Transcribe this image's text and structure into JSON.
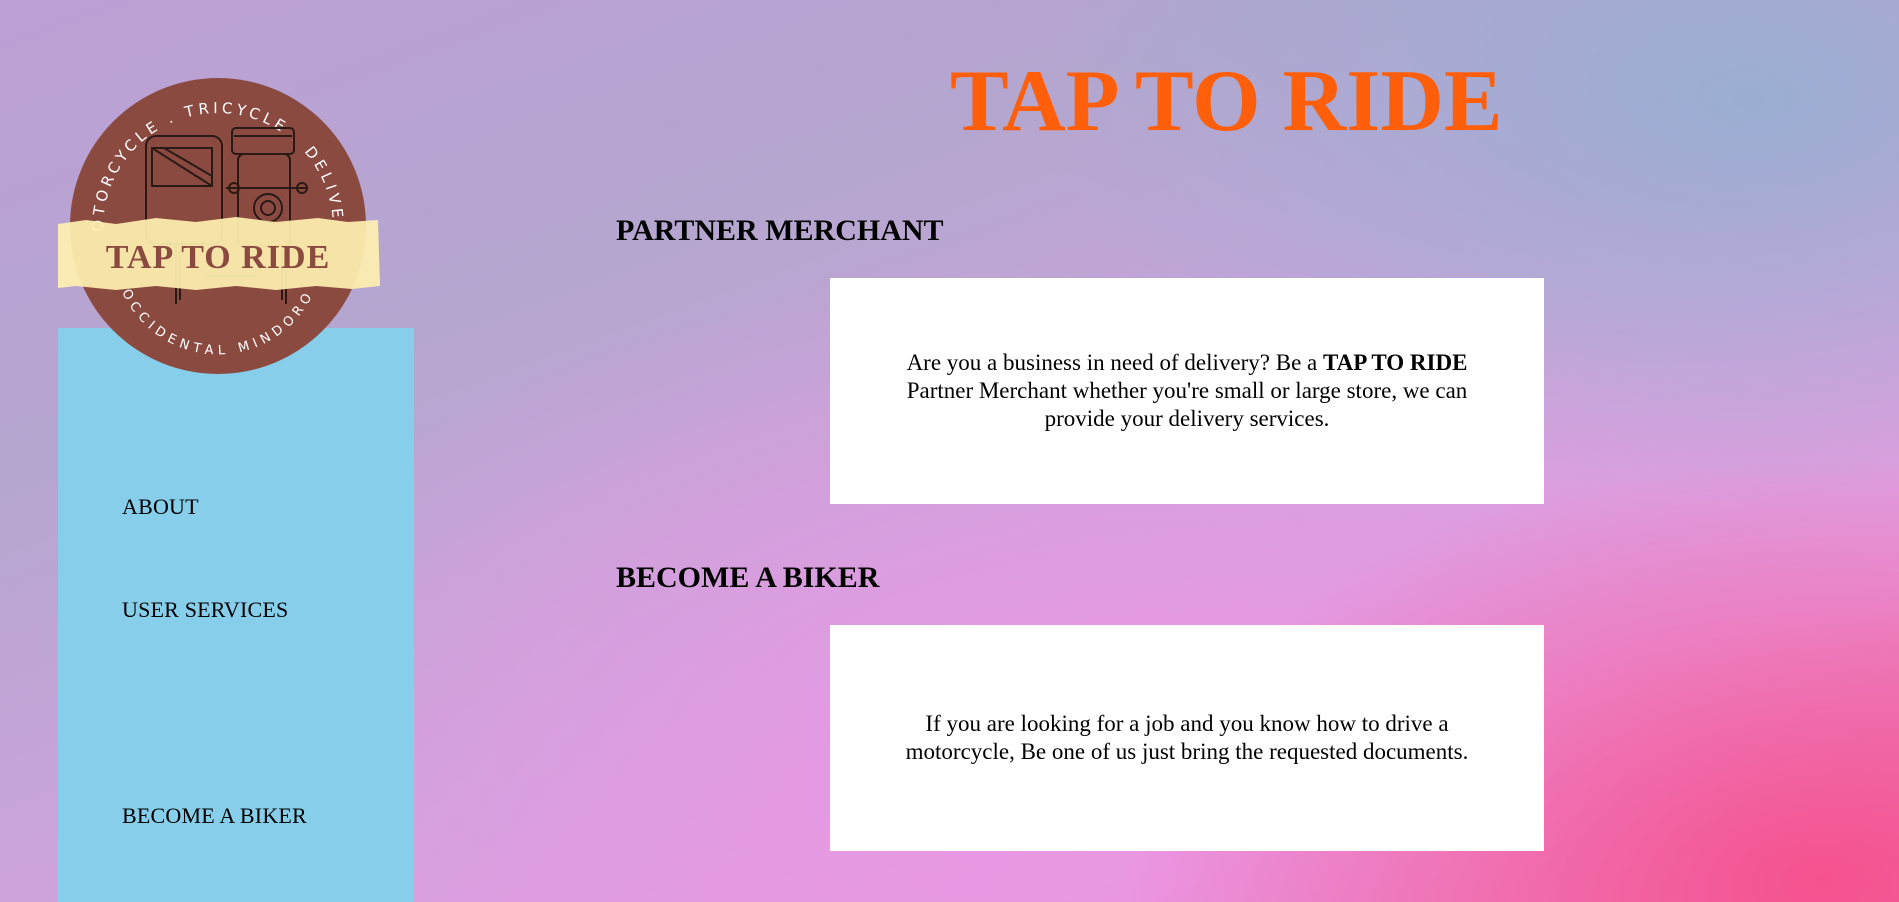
{
  "logo": {
    "top_arc": "MOTORCYCLE . TRICYCLE . DELIVERY",
    "bottom_arc": "OCCIDENTAL MINDORO",
    "banner": "TAP TO RIDE",
    "color_brown": "#8b4a3f",
    "color_banner": "#fff0b0"
  },
  "nav": {
    "about": "ABOUT",
    "user_services": "USER SERVICES",
    "become_biker": "BECOME A BIKER",
    "background": "#87ceeb"
  },
  "hero": {
    "title": "TAP TO RIDE",
    "color": "#ff5f0a"
  },
  "sections": {
    "merchant": {
      "heading": "PARTNER MERCHANT",
      "text_before": "Are you a business in need of delivery? Be a ",
      "text_bold": "TAP TO RIDE",
      "text_after": " Partner Merchant whether you're small or large store, we can provide your delivery services."
    },
    "biker": {
      "heading": "BECOME A BIKER",
      "text": "If you are looking for a job and you know how to drive a motorcycle, Be one of us just bring the requested documents."
    }
  }
}
